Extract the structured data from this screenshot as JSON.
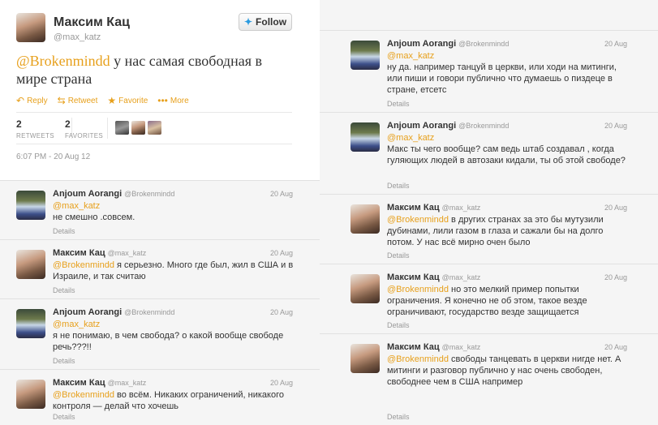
{
  "main_tweet": {
    "name": "Максим Кац",
    "handle": "@max_katz",
    "follow_label": "Follow",
    "mention": "@Brokenmindd",
    "text": " у нас самая свободная в мире страна",
    "actions": [
      {
        "label": "Reply",
        "icon": "reply-icon"
      },
      {
        "label": "Retweet",
        "icon": "retweet-icon"
      },
      {
        "label": "Favorite",
        "icon": "star-icon"
      },
      {
        "label": "More",
        "icon": "more-icon"
      }
    ],
    "retweets_count": "2",
    "retweets_label": "RETWEETS",
    "favorites_count": "2",
    "favorites_label": "FAVORITES",
    "timestamp": "6:07 PM - 20 Aug 12"
  },
  "left_replies": [
    {
      "name": "Anjoum Aorangi",
      "handle": "@Brokenmindd",
      "date": "20 Aug",
      "mention": "@max_katz",
      "text": "не смешно .совсем.",
      "details": "Details",
      "avatar": "anjoum"
    },
    {
      "name": "Максим Кац",
      "handle": "@max_katz",
      "date": "20 Aug",
      "mention": "@Brokenmindd",
      "text": " я серьезно. Много где был, жил в США и в Израиле,  и так считаю",
      "details": "Details",
      "avatar": "katz"
    },
    {
      "name": "Anjoum Aorangi",
      "handle": "@Brokenmindd",
      "date": "20 Aug",
      "mention": "@max_katz",
      "text": "я не понимаю, в чем свобода? о какой вообще свободе речь???!!",
      "details": "Details",
      "avatar": "anjoum"
    },
    {
      "name": "Максим Кац",
      "handle": "@max_katz",
      "date": "20 Aug",
      "mention": "@Brokenmindd",
      "text": " во всём. Никаких ограничений, никакого контроля — делай что хочешь",
      "details": "Details",
      "avatar": "katz"
    }
  ],
  "right_replies": [
    {
      "name": "Anjoum Aorangi",
      "handle": "@Brokenmindd",
      "date": "20 Aug",
      "mention": "@max_katz",
      "text": "ну да. например танцуй в церкви, или ходи на митинги, или пиши и говори публично что думаешь о пиздеце в стране, етсетс",
      "details": "Details",
      "avatar": "anjoum"
    },
    {
      "name": "Anjoum Aorangi",
      "handle": "@Brokenmindd",
      "date": "20 Aug",
      "mention": "@max_katz",
      "text": "Макс ты чего вообще? сам ведь штаб создавал , когда гуляющих людей в автозаки кидали, ты об этой свободе?",
      "details": "Details",
      "avatar": "anjoum"
    },
    {
      "name": "Максим Кац",
      "handle": "@max_katz",
      "date": "20 Aug",
      "mention": "@Brokenmindd",
      "text": " в других странах за это бы мутузили дубинами, лили газом в глаза и сажали бы на долго потом. У нас всё мирно очен было",
      "details": "Details",
      "avatar": "katz"
    },
    {
      "name": "Максим Кац",
      "handle": "@max_katz",
      "date": "20 Aug",
      "mention": "@Brokenmindd",
      "text": " но это мелкий пример попытки ограничения. Я конечно не об этом, такое везде ограничивают, государство везде защищается",
      "details": "Details",
      "avatar": "katz"
    },
    {
      "name": "Максим Кац",
      "handle": "@max_katz",
      "date": "20 Aug",
      "mention": "@Brokenmindd",
      "text": " свободы танцевать в церкви нигде нет. А митинги и разговор публично у нас очень свободен, свободнее чем в США например",
      "details": "Details",
      "avatar": "katz"
    }
  ],
  "colors": {
    "accent": "#e7a01c",
    "twitter_blue": "#2b9be0"
  }
}
